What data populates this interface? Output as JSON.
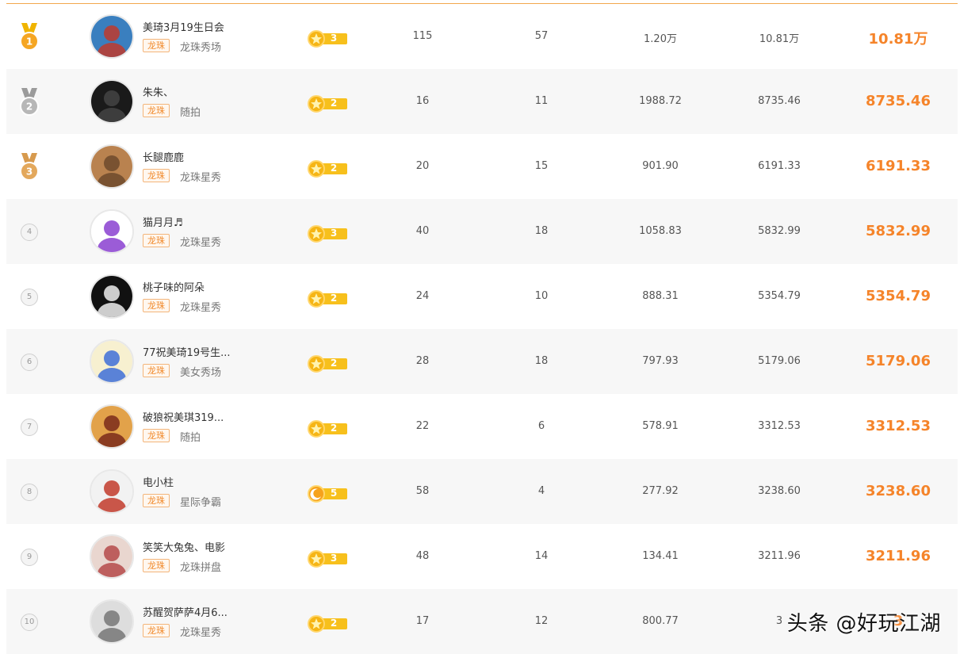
{
  "colors": {
    "accent": "#f5842a",
    "tag_border": "#f3b57a",
    "row_alt": "#f7f7f7",
    "level_yellow": "#f7c01c"
  },
  "rows": [
    {
      "rank": "1",
      "name": "美琦3月19生日会",
      "tag": "龙珠",
      "category": "龙珠秀场",
      "level": "3",
      "level_icon": "star",
      "c1": "115",
      "c2": "57",
      "c3": "1.20万",
      "c4": "10.81万",
      "score": "10.81万"
    },
    {
      "rank": "2",
      "name": "朱朱、",
      "tag": "龙珠",
      "category": "随拍",
      "level": "2",
      "level_icon": "star",
      "c1": "16",
      "c2": "11",
      "c3": "1988.72",
      "c4": "8735.46",
      "score": "8735.46"
    },
    {
      "rank": "3",
      "name": "长腿鹿鹿",
      "tag": "龙珠",
      "category": "龙珠星秀",
      "level": "2",
      "level_icon": "star",
      "c1": "20",
      "c2": "15",
      "c3": "901.90",
      "c4": "6191.33",
      "score": "6191.33"
    },
    {
      "rank": "4",
      "name": "猫月月♬",
      "tag": "龙珠",
      "category": "龙珠星秀",
      "level": "3",
      "level_icon": "star",
      "c1": "40",
      "c2": "18",
      "c3": "1058.83",
      "c4": "5832.99",
      "score": "5832.99"
    },
    {
      "rank": "5",
      "name": "桃子味的阿朵",
      "tag": "龙珠",
      "category": "龙珠星秀",
      "level": "2",
      "level_icon": "star",
      "c1": "24",
      "c2": "10",
      "c3": "888.31",
      "c4": "5354.79",
      "score": "5354.79"
    },
    {
      "rank": "6",
      "name": "77祝美琦19号生...",
      "tag": "龙珠",
      "category": "美女秀场",
      "level": "2",
      "level_icon": "star",
      "c1": "28",
      "c2": "18",
      "c3": "797.93",
      "c4": "5179.06",
      "score": "5179.06"
    },
    {
      "rank": "7",
      "name": "破狼祝美琪319...",
      "tag": "龙珠",
      "category": "随拍",
      "level": "2",
      "level_icon": "star",
      "c1": "22",
      "c2": "6",
      "c3": "578.91",
      "c4": "3312.53",
      "score": "3312.53"
    },
    {
      "rank": "8",
      "name": "电小柱",
      "tag": "龙珠",
      "category": "星际争霸",
      "level": "5",
      "level_icon": "moon",
      "c1": "58",
      "c2": "4",
      "c3": "277.92",
      "c4": "3238.60",
      "score": "3238.60"
    },
    {
      "rank": "9",
      "name": "笑笑大兔兔、电影",
      "tag": "龙珠",
      "category": "龙珠拼盘",
      "level": "3",
      "level_icon": "star",
      "c1": "48",
      "c2": "14",
      "c3": "134.41",
      "c4": "3211.96",
      "score": "3211.96"
    },
    {
      "rank": "10",
      "name": "苏醒贺萨萨4月6...",
      "tag": "龙珠",
      "category": "龙珠星秀",
      "level": "2",
      "level_icon": "star",
      "c1": "17",
      "c2": "12",
      "c3": "800.77",
      "c4": "3",
      "score": "3"
    }
  ],
  "watermark": "头条 @好玩江湖"
}
